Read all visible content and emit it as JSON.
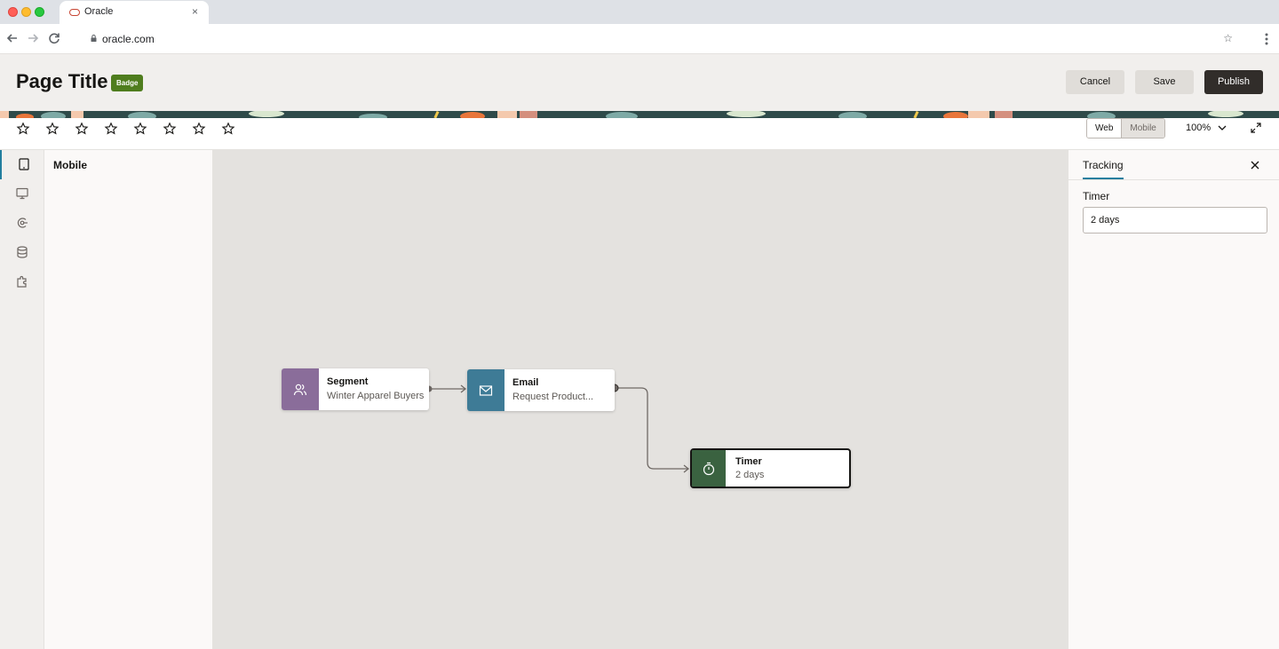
{
  "browser": {
    "tab_title": "Oracle",
    "tab_close": "×",
    "url": "oracle.com",
    "bookmark_star": "☆"
  },
  "header": {
    "title": "Page Title",
    "badge": "Badge",
    "cancel_label": "Cancel",
    "save_label": "Save",
    "publish_label": "Publish"
  },
  "toolbar": {
    "rating_icons": [
      "star-icon",
      "star-icon",
      "star-icon",
      "star-icon",
      "star-icon",
      "star-icon",
      "star-icon",
      "star-icon"
    ],
    "view_toggle": [
      "Web",
      "Mobile"
    ],
    "view_selected": "Web",
    "zoom": "100%"
  },
  "left_rail": {
    "items": [
      "tablet-icon",
      "monitor-icon",
      "flow-icon",
      "database-icon",
      "puzzle-icon"
    ],
    "active": "tablet-icon"
  },
  "side_panel": {
    "title": "Mobile"
  },
  "canvas": {
    "nodes": [
      {
        "type": "Segment",
        "title": "Segment",
        "subtitle": "Winter Apparel Buyers",
        "icon": "users-icon",
        "color": "#8a6d9a"
      },
      {
        "type": "Email",
        "title": "Email",
        "subtitle": "Request Product...",
        "icon": "mail-icon",
        "color": "#3e7b96"
      },
      {
        "type": "Timer",
        "title": "Timer",
        "subtitle": "2 days",
        "icon": "stopwatch-icon",
        "color": "#3a6240",
        "selected": true
      }
    ]
  },
  "inspector": {
    "tab": "Tracking",
    "field_label": "Timer",
    "field_value": "2 days"
  },
  "colors": {
    "accent": "#227e9e",
    "publish_bg": "#312d2a",
    "badge_bg": "#4f7d1e"
  }
}
